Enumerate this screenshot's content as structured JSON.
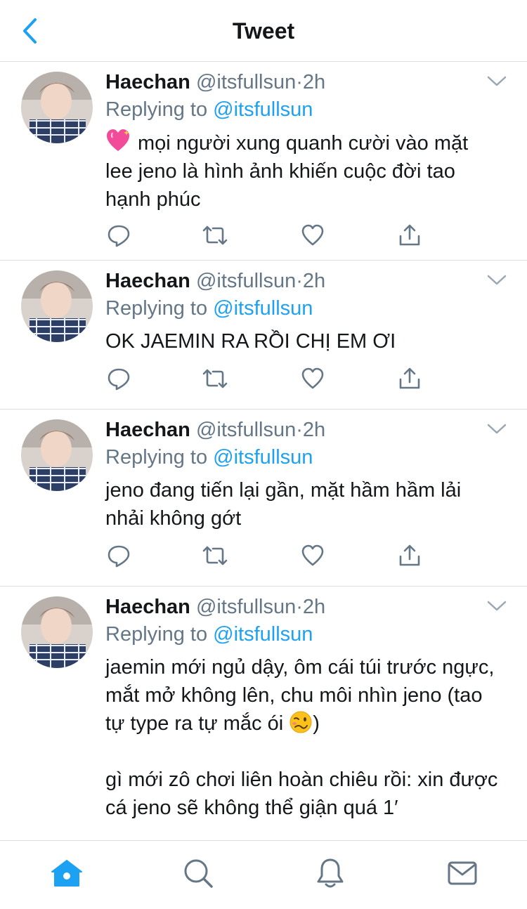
{
  "header": {
    "title": "Tweet",
    "back_icon": "chevron-left-icon"
  },
  "colors": {
    "accent": "#1da1f2",
    "muted": "#657786",
    "text": "#14171a",
    "divider": "#dcdfe2"
  },
  "tweets": [
    {
      "name": "Haechan",
      "handle": "@itsfullsun",
      "dot": "·",
      "time": "2h",
      "replying_prefix": "Replying to",
      "replying_handle": "@itsfullsun",
      "lead_emoji": "sparkling-heart-emoji",
      "lines": [
        "mọi người xung quanh cười vào mặt lee jeno là hình ảnh khiến cuộc đời tao hạnh phúc"
      ]
    },
    {
      "name": "Haechan",
      "handle": "@itsfullsun",
      "dot": "·",
      "time": "2h",
      "replying_prefix": "Replying to",
      "replying_handle": "@itsfullsun",
      "lines": [
        "OK JAEMIN RA RỒI CHỊ EM ƠI"
      ]
    },
    {
      "name": "Haechan",
      "handle": "@itsfullsun",
      "dot": "·",
      "time": "2h",
      "replying_prefix": "Replying to",
      "replying_handle": "@itsfullsun",
      "lines": [
        "jeno đang tiến lại gần, mặt hầm hầm lải nhải không gớt"
      ]
    },
    {
      "name": "Haechan",
      "handle": "@itsfullsun",
      "dot": "·",
      "time": "2h",
      "replying_prefix": "Replying to",
      "replying_handle": "@itsfullsun",
      "para1": "jaemin mới ngủ dậy, ôm cái túi trước ngực, mắt mở không lên, chu môi nhìn jeno (tao tự type ra tự mắc ói",
      "para1_end": ")",
      "face_emoji": "woozy-face-emoji",
      "para2": "gì mới zô chơi liên hoàn chiêu rồi: xin được cá jeno sẽ không thể giận quá 1′"
    }
  ],
  "tabbar": {
    "icons": [
      "home-icon",
      "search-icon",
      "bell-icon",
      "mail-icon"
    ],
    "active": "home-icon"
  }
}
